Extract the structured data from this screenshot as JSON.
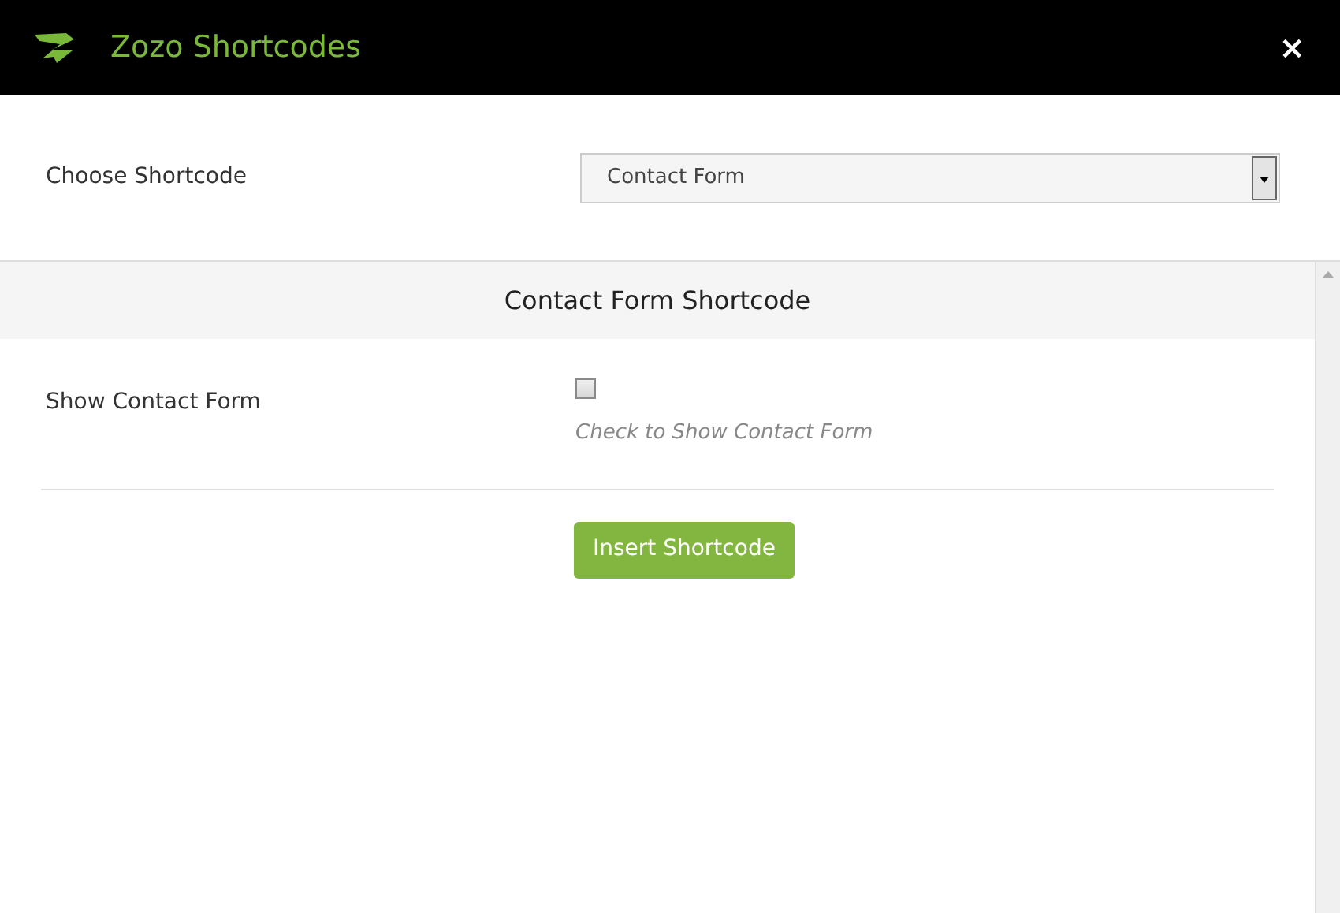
{
  "window": {
    "title": "Zozo Shortcodes",
    "close": "×"
  },
  "chooser": {
    "label": "Choose Shortcode",
    "value": "Contact Form"
  },
  "section": {
    "title": "Contact Form Shortcode",
    "fields": [
      {
        "kind": "checkbox",
        "label": "Show Contact Form",
        "checked": false,
        "hint": "Check to Show Contact Form"
      }
    ],
    "button": "Insert Shortcode"
  }
}
